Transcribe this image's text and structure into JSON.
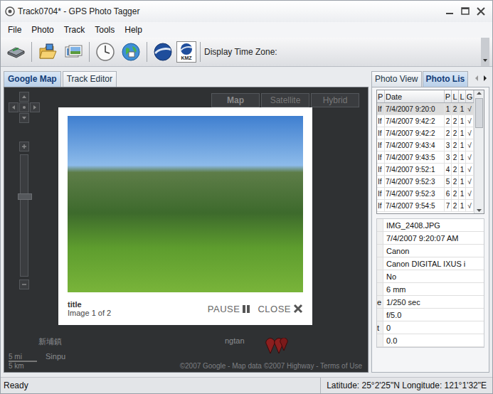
{
  "window": {
    "title": "Track0704* - GPS Photo Tagger"
  },
  "menu": [
    "File",
    "Photo",
    "Track",
    "Tools",
    "Help"
  ],
  "toolbar": {
    "kmz_label": "KMZ",
    "time_zone_label": "Display Time Zone:"
  },
  "left_tabs": [
    {
      "label": "Google Map",
      "selected": true
    },
    {
      "label": "Track Editor",
      "selected": false
    }
  ],
  "map": {
    "types": [
      {
        "label": "Map",
        "selected": true
      },
      {
        "label": "Satellite",
        "selected": false
      },
      {
        "label": "Hybrid",
        "selected": false
      }
    ],
    "zoom_level": 0.63,
    "scale": [
      "5 mi",
      "5 km"
    ],
    "places": [
      "新埔鎮",
      "Sinpu",
      "ngtan"
    ],
    "copyright": "©2007 Google - Map data ©2007 Highway - Terms of Use"
  },
  "lightbox": {
    "title": "title",
    "counter": "Image 1 of 2",
    "pause": "PAUSE",
    "close": "CLOSE"
  },
  "right_tabs": [
    {
      "label": "Photo View",
      "selected": false
    },
    {
      "label": "Photo Lis",
      "selected": true
    }
  ],
  "photo_list": {
    "columns": [
      "P",
      "Date",
      "P",
      "L",
      "L",
      "G"
    ],
    "rows": [
      {
        "cells": [
          "If",
          "7/4/2007 9:20:0",
          "1",
          "2",
          "1",
          "√"
        ],
        "selected": true
      },
      {
        "cells": [
          "If",
          "7/4/2007 9:42:2",
          "2",
          "2",
          "1",
          "√"
        ],
        "selected": false
      },
      {
        "cells": [
          "If",
          "7/4/2007 9:42:2",
          "2",
          "2",
          "1",
          "√"
        ],
        "selected": false
      },
      {
        "cells": [
          "If",
          "7/4/2007 9:43:4",
          "3",
          "2",
          "1",
          "√"
        ],
        "selected": false
      },
      {
        "cells": [
          "If",
          "7/4/2007 9:43:5",
          "3",
          "2",
          "1",
          "√"
        ],
        "selected": false
      },
      {
        "cells": [
          "If",
          "7/4/2007 9:52:1",
          "4",
          "2",
          "1",
          "√"
        ],
        "selected": false
      },
      {
        "cells": [
          "If",
          "7/4/2007 9:52:3",
          "5",
          "2",
          "1",
          "√"
        ],
        "selected": false
      },
      {
        "cells": [
          "If",
          "7/4/2007 9:52:3",
          "6",
          "2",
          "1",
          "√"
        ],
        "selected": false
      },
      {
        "cells": [
          "If",
          "7/4/2007 9:54:5",
          "7",
          "2",
          "1",
          "√"
        ],
        "selected": false
      }
    ]
  },
  "properties": [
    {
      "label": "",
      "value": "IMG_2408.JPG"
    },
    {
      "label": "",
      "value": "7/4/2007 9:20:07 AM"
    },
    {
      "label": "",
      "value": "Canon"
    },
    {
      "label": "",
      "value": "Canon DIGITAL IXUS i"
    },
    {
      "label": "",
      "value": "No"
    },
    {
      "label": "",
      "value": "6 mm"
    },
    {
      "label": "e",
      "value": "1/250 sec"
    },
    {
      "label": "",
      "value": "f/5.0"
    },
    {
      "label": "t",
      "value": "0"
    },
    {
      "label": "",
      "value": "0.0"
    }
  ],
  "status_bar": {
    "text": "Ready",
    "coords": "Latitude: 25°2'25\"N Longitude: 121°1'32\"E"
  }
}
